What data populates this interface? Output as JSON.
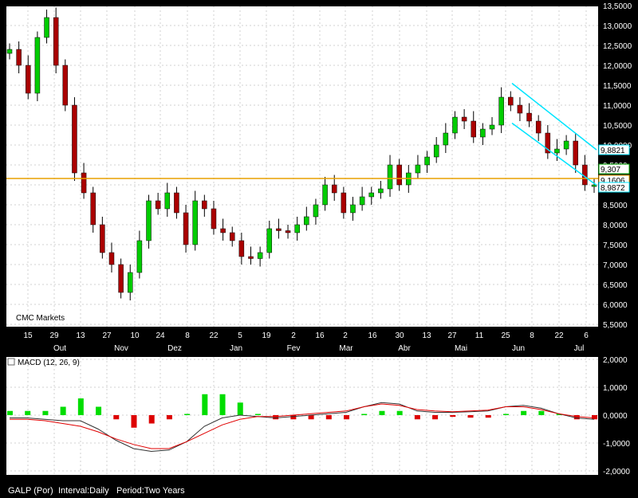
{
  "chart_data": [
    {
      "type": "candlestick",
      "watermark": "CMC Markets",
      "y_ticks": [
        "13,5000",
        "13,0000",
        "12,5000",
        "12,0000",
        "11,5000",
        "11,0000",
        "10,5000",
        "10,0000",
        "9,5000",
        "9,0000",
        "8,5000",
        "8,0000",
        "7,5000",
        "7,0000",
        "6,5000",
        "6,0000",
        "5,5000"
      ],
      "ylim": [
        5.5,
        13.5
      ],
      "x_ticks": [
        "15",
        "29",
        "13",
        "27",
        "10",
        "24",
        "8",
        "22",
        "5",
        "19",
        "2",
        "16",
        "2",
        "16",
        "30",
        "13",
        "27",
        "11",
        "25",
        "8",
        "22",
        "6"
      ],
      "months": [
        "Out",
        "Nov",
        "Dez",
        "Jan",
        "Fev",
        "Mar",
        "Abr",
        "Mai",
        "Jun",
        "Jul"
      ],
      "price_labels": [
        "9,8821",
        "9,307",
        "9,1606",
        "8,9872"
      ],
      "colors": {
        "up": "#00cc00",
        "down": "#aa0000",
        "horizontal_line": "#e8a000",
        "channel": "#00e5ff"
      },
      "horizontal_level": 9.16,
      "channel_upper": [
        [
          0,
          11.55
        ],
        [
          1,
          9.88
        ]
      ],
      "channel_lower": [
        [
          0,
          10.55
        ],
        [
          1,
          8.99
        ]
      ],
      "close_path": [
        12.4,
        12.0,
        11.3,
        12.7,
        13.2,
        12.0,
        11.0,
        9.3,
        8.8,
        8.0,
        7.3,
        7.0,
        6.3,
        6.8,
        7.6,
        8.6,
        8.4,
        8.8,
        8.3,
        7.5,
        8.6,
        8.4,
        7.9,
        7.8,
        7.6,
        7.2,
        7.15,
        7.3,
        7.9,
        7.85,
        7.8,
        8.0,
        8.2,
        8.5,
        9.0,
        8.8,
        8.3,
        8.5,
        8.7,
        8.8,
        8.9,
        9.5,
        9.0,
        9.3,
        9.5,
        9.7,
        10.0,
        10.3,
        10.7,
        10.6,
        10.2,
        10.4,
        10.5,
        11.2,
        11.0,
        10.8,
        10.6,
        10.3,
        9.8,
        9.9,
        10.1,
        9.5,
        9.0,
        9.0
      ],
      "indicator": {
        "title": "MACD (12, 26, 9)",
        "y_ticks": [
          "2,0000",
          "1,0000",
          "0,0000",
          "-1,0000",
          "-2,0000"
        ],
        "ylim": [
          -2.0,
          2.0
        ],
        "macd_path": [
          -0.1,
          -0.1,
          -0.15,
          -0.2,
          -0.2,
          -0.5,
          -0.9,
          -1.2,
          -1.3,
          -1.25,
          -0.95,
          -0.4,
          -0.1,
          0.0,
          -0.05,
          -0.1,
          -0.05,
          0.0,
          0.05,
          0.1,
          0.3,
          0.45,
          0.4,
          0.15,
          0.1,
          0.1,
          0.12,
          0.15,
          0.3,
          0.35,
          0.25,
          0.05,
          -0.1,
          -0.15
        ],
        "signal_path": [
          -0.15,
          -0.15,
          -0.2,
          -0.3,
          -0.4,
          -0.6,
          -0.85,
          -1.05,
          -1.2,
          -1.2,
          -0.95,
          -0.65,
          -0.35,
          -0.15,
          -0.05,
          -0.05,
          0.0,
          0.05,
          0.1,
          0.15,
          0.3,
          0.4,
          0.35,
          0.2,
          0.15,
          0.12,
          0.15,
          0.18,
          0.3,
          0.3,
          0.2,
          0.05,
          -0.05,
          -0.1
        ]
      }
    }
  ],
  "footer": {
    "symbol": "GALP (Por)",
    "interval": "Interval:Daily",
    "period": "Period:Two Years"
  }
}
